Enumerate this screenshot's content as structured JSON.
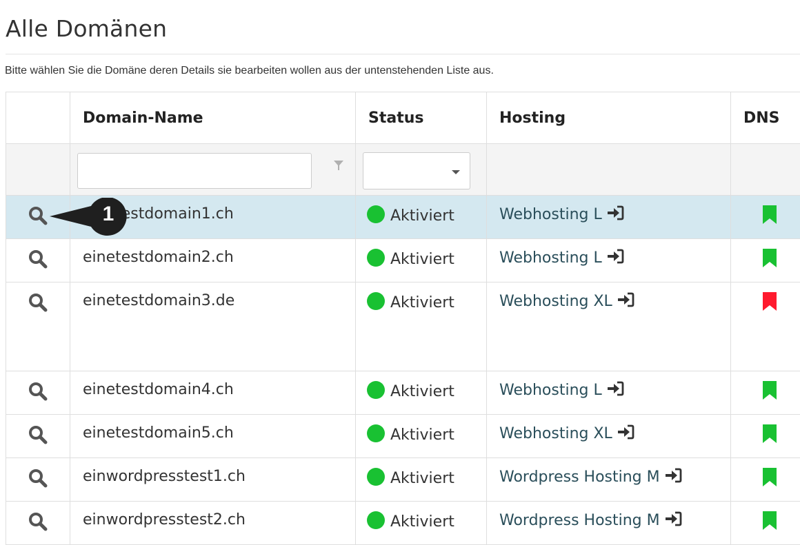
{
  "page": {
    "title": "Alle Domänen",
    "intro": "Bitte wählen Sie die Domäne deren Details sie bearbeiten wollen aus der untenstehenden Liste aus."
  },
  "table": {
    "columns": [
      "",
      "Domain-Name",
      "Status",
      "Hosting",
      "DNS"
    ],
    "filters": {
      "name_value": "",
      "status_value": ""
    },
    "rows": [
      {
        "name": "einetestdomain1.ch",
        "status": "Aktiviert",
        "hosting": "Webhosting L",
        "dns_color": "#19c132"
      },
      {
        "name": "einetestdomain2.ch",
        "status": "Aktiviert",
        "hosting": "Webhosting L",
        "dns_color": "#19c132"
      },
      {
        "name": "einetestdomain3.de",
        "status": "Aktiviert",
        "hosting": "Webhosting XL",
        "dns_color": "#ff1a2e"
      },
      {
        "name": "einetestdomain4.ch",
        "status": "Aktiviert",
        "hosting": "Webhosting L",
        "dns_color": "#19c132"
      },
      {
        "name": "einetestdomain5.ch",
        "status": "Aktiviert",
        "hosting": "Webhosting XL",
        "dns_color": "#19c132"
      },
      {
        "name": "einwordpresstest1.ch",
        "status": "Aktiviert",
        "hosting": "Wordpress Hosting M",
        "dns_color": "#19c132"
      },
      {
        "name": "einwordpresstest2.ch",
        "status": "Aktiviert",
        "hosting": "Wordpress Hosting M",
        "dns_color": "#19c132"
      }
    ]
  },
  "callout": {
    "number": "1"
  },
  "colors": {
    "status_active": "#19c132",
    "selected_row": "#d4e8f0",
    "dns_ok": "#19c132",
    "dns_error": "#ff1a2e"
  }
}
